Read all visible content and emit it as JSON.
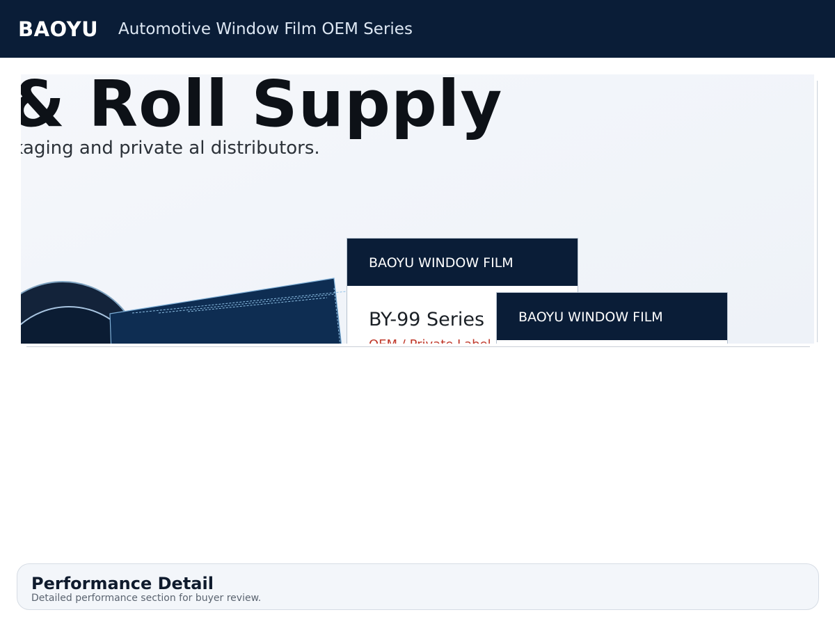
{
  "header": {
    "brand": "BAOYU",
    "subtitle": "Automotive Window Film OEM Series"
  },
  "hero": {
    "title": "& Roll Supply",
    "description": "y, carton packaging and private al distributors.",
    "products": [
      {
        "brand_label": "BAOYU WINDOW FILM",
        "series_name": "BY-99 Series",
        "tag": "OEM / Private Label"
      },
      {
        "brand_label": "BAOYU WINDOW FILM"
      }
    ]
  },
  "performance": {
    "title": "Performance Detail",
    "subtitle": "Detailed performance section for buyer review."
  },
  "colors": {
    "navy": "#0a1d37",
    "accent_red": "#c0392b",
    "hero_bg": "#f5f7fb"
  }
}
